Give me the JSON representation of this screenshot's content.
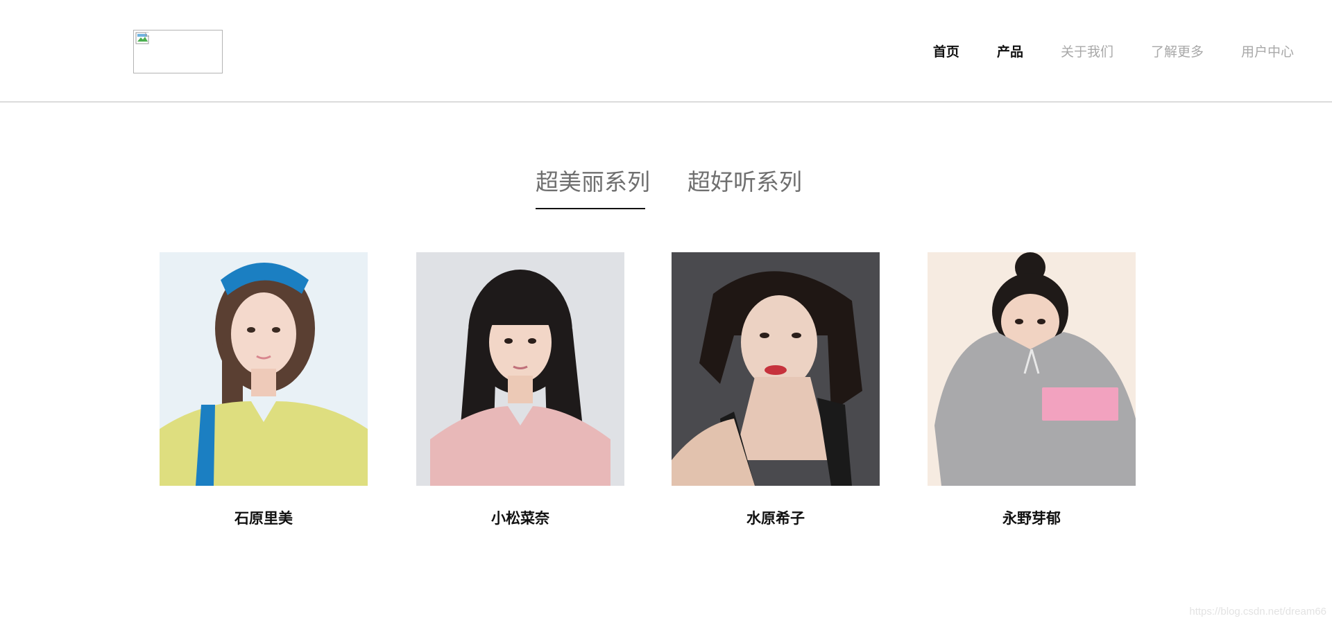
{
  "nav": {
    "items": [
      {
        "label": "首页",
        "active": true
      },
      {
        "label": "产品",
        "active": true
      },
      {
        "label": "关于我们",
        "active": false
      },
      {
        "label": "了解更多",
        "active": false
      },
      {
        "label": "用户中心",
        "active": false
      }
    ]
  },
  "tabs": {
    "items": [
      "超美丽系列",
      "超好听系列"
    ],
    "selected": "超美丽系列"
  },
  "cards": [
    {
      "name": "石原里美",
      "bg": "#e9f1f6",
      "shirt": "#dede7f",
      "hair": "#5a3f32",
      "accent": "#1b7fc2"
    },
    {
      "name": "小松菜奈",
      "bg": "#dfe1e5",
      "shirt": "#e8b8b8",
      "hair": "#1e1a1a",
      "accent": "#d9a0a4"
    },
    {
      "name": "水原希子",
      "bg": "#4a4a4e",
      "shirt": "#1a1a1a",
      "hair": "#1f1714",
      "accent": "#c6323c"
    },
    {
      "name": "永野芽郁",
      "bg": "#f6ebe1",
      "shirt": "#a9a9ab",
      "hair": "#1f1a18",
      "accent": "#e58aa8"
    }
  ],
  "watermark": "https://blog.csdn.net/dream66"
}
